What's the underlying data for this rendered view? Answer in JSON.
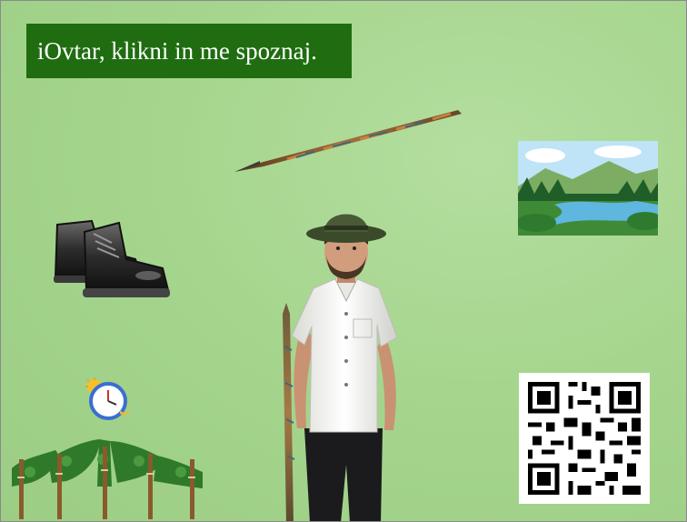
{
  "title": "iOvtar, klikni in me spoznaj.",
  "colors": {
    "background": "#a6d68e",
    "title_bg": "#1f6d10",
    "title_text": "#ffffff"
  },
  "objects": {
    "top_item": "spear-icon",
    "left_item": "boots-icon",
    "right_item": "landscape-icon",
    "clock_item": "clock-icon",
    "bottom_left_item": "vineyard-icon",
    "bottom_right_item": "qr-code-icon",
    "character": "shepherd-character"
  }
}
